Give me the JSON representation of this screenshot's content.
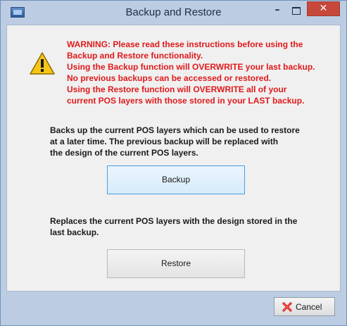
{
  "window": {
    "title": "Backup and Restore",
    "minimize_glyph": "–",
    "close_glyph": "✕"
  },
  "warning": {
    "icon": "warning-icon",
    "lines": [
      "WARNING: Please read these instructions before using the",
      "Backup and Restore functionality.",
      "Using the Backup function will OVERWRITE your last backup.",
      "No previous backups can be accessed or restored.",
      "Using the Restore function will OVERWRITE all of your",
      "current POS layers with those stored in your LAST backup."
    ]
  },
  "backup": {
    "description_lines": [
      "Backs up the current POS layers which can be used to restore",
      "at a later time.  The previous backup will be replaced with",
      "the design of the current POS layers."
    ],
    "button_label": "Backup"
  },
  "restore": {
    "description_lines": [
      "Replaces the current POS layers with the design stored in the",
      "last backup."
    ],
    "button_label": "Restore"
  },
  "footer": {
    "cancel_label": "Cancel",
    "cancel_icon": "red-x-icon"
  },
  "colors": {
    "warning_text": "#e0191b",
    "frame": "#bccde3",
    "client_bg": "#f0f0f0",
    "close_button": "#c7483b"
  }
}
